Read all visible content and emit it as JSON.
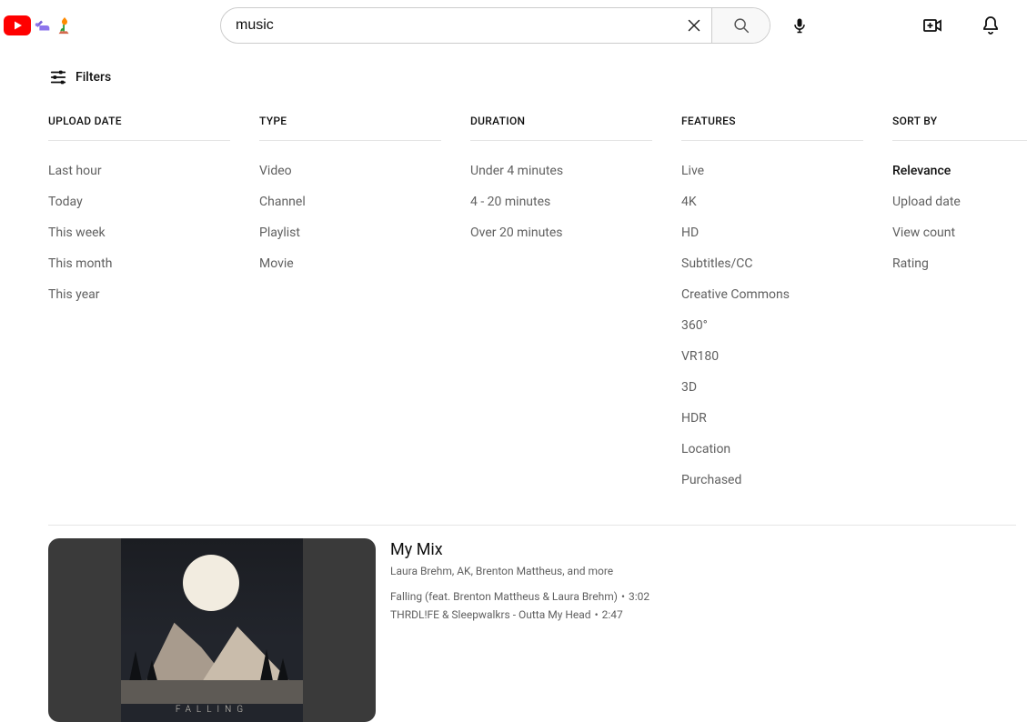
{
  "search": {
    "value": "music",
    "placeholder": "Search"
  },
  "filters": {
    "toggle_label": "Filters",
    "columns": [
      {
        "header": "UPLOAD DATE",
        "items": [
          "Last hour",
          "Today",
          "This week",
          "This month",
          "This year"
        ],
        "active": -1
      },
      {
        "header": "TYPE",
        "items": [
          "Video",
          "Channel",
          "Playlist",
          "Movie"
        ],
        "active": -1
      },
      {
        "header": "DURATION",
        "items": [
          "Under 4 minutes",
          "4 - 20 minutes",
          "Over 20 minutes"
        ],
        "active": -1
      },
      {
        "header": "FEATURES",
        "items": [
          "Live",
          "4K",
          "HD",
          "Subtitles/CC",
          "Creative Commons",
          "360°",
          "VR180",
          "3D",
          "HDR",
          "Location",
          "Purchased"
        ],
        "active": -1
      },
      {
        "header": "SORT BY",
        "items": [
          "Relevance",
          "Upload date",
          "View count",
          "Rating"
        ],
        "active": 0
      }
    ]
  },
  "result": {
    "title": "My Mix",
    "byline": "Laura Brehm, AK, Brenton Mattheus, and more",
    "thumb_label": "FALLING",
    "tracks": [
      {
        "title": "Falling (feat. Brenton Mattheus & Laura Brehm)",
        "duration": "3:02"
      },
      {
        "title": "THRDL!FE & Sleepwalkrs - Outta My Head",
        "duration": "2:47"
      }
    ]
  }
}
